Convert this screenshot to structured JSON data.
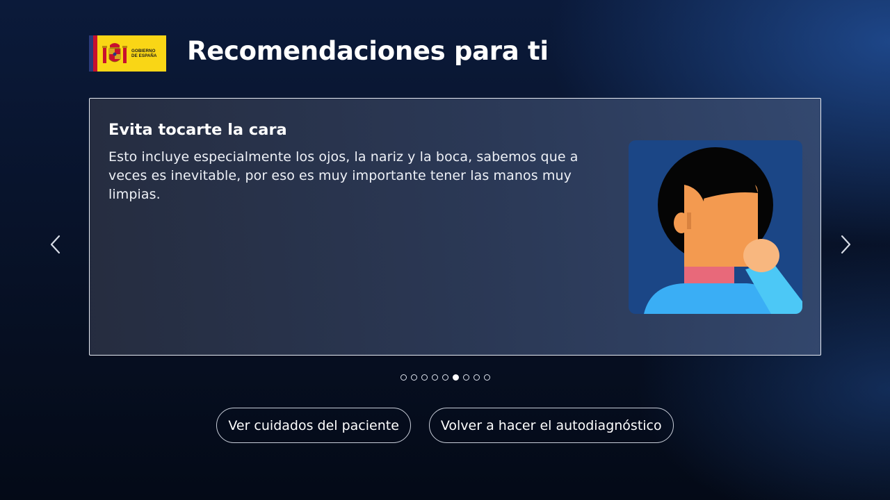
{
  "header": {
    "logo": {
      "name": "gobierno-de-espana-logo",
      "line1": "GOBIERNO",
      "line2": "DE ESPAÑA",
      "colors": {
        "blue": "#2b3a7a",
        "red": "#c8102e",
        "yellow": "#f9d616"
      }
    },
    "title": "Recomendaciones para ti"
  },
  "carousel": {
    "prev_icon": "chevron-left-icon",
    "next_icon": "chevron-right-icon",
    "slide": {
      "title": "Evita tocarte la cara",
      "text": "Esto incluye especialmente los ojos, la nariz y la boca, sabemos que a veces es inevitable, por eso es muy importante tener las manos muy limpias.",
      "illustration": "person-touching-face-illustration"
    },
    "total_slides": 9,
    "active_index": 5
  },
  "actions": {
    "patient_care_label": "Ver cuidados del paciente",
    "retake_test_label": "Volver a hacer el autodiagnóstico"
  },
  "colors": {
    "background": "#071126",
    "card_border": "#e8ecf4",
    "illustration_bg": "#1b4686",
    "skin": "#f39a50",
    "hair": "#050505",
    "shirt": "#3aaef5",
    "neck": "#e8697a"
  }
}
